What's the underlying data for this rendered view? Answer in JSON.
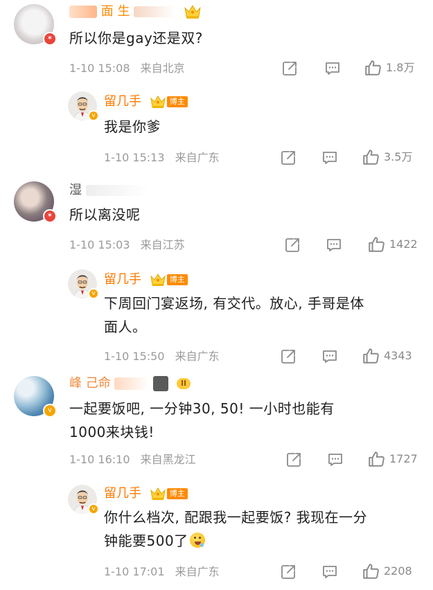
{
  "comments": [
    {
      "name": "面 生",
      "text": "所以你是gay还是双?",
      "time": "1-10 15:08",
      "location": "来自北京",
      "likes": "1.8万"
    },
    {
      "name": "留几手",
      "tag": "博主",
      "text": "我是你爹",
      "time": "1-10 15:13",
      "location": "来自广东",
      "likes": "3.5万"
    },
    {
      "name": "湿",
      "text": "所以离没呢",
      "time": "1-10 15:03",
      "location": "来自江苏",
      "likes": "1422"
    },
    {
      "name": "留几手",
      "tag": "博主",
      "text_line1": "下周回门宴返场, 有交代。放心, 手哥是体",
      "text_line2": "面人。",
      "time": "1-10 15:50",
      "location": "来自广东",
      "likes": "4343"
    },
    {
      "name": "峰 己命",
      "level": "II",
      "text_line1": "一起要饭吧, 一分钟30, 50! 一小时也能有",
      "text_line2": "1000来块钱!",
      "time": "1-10 16:10",
      "location": "来自黑龙江",
      "likes": "1727"
    },
    {
      "name": "留几手",
      "tag": "博主",
      "text_line1": "你什么档次, 配跟我一起要饭? 我现在一分",
      "text_line2": "钟能要500了",
      "time": "1-10 17:01",
      "location": "来自广东",
      "likes": "2208"
    }
  ],
  "icons": {
    "share": "share-icon",
    "comment": "comment-icon",
    "like": "thumbs-up-icon",
    "crown": "crown-icon",
    "emoji": "drooling-face-emoji"
  },
  "colors": {
    "name_accent": "#ff7a00",
    "meta_gray": "#9a9a9a",
    "text": "#1f1f1f"
  }
}
